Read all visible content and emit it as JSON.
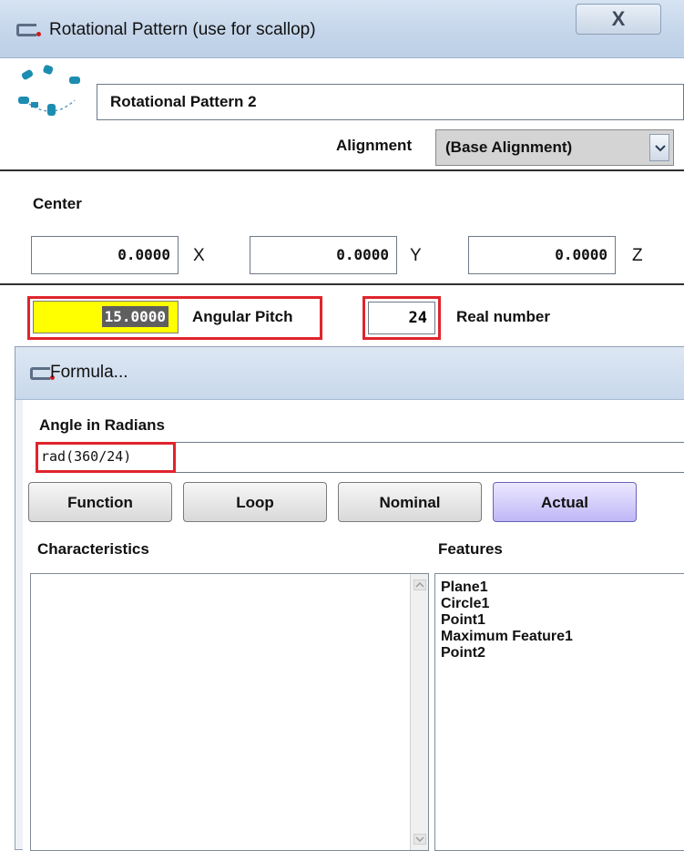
{
  "main_window": {
    "title": "Rotational Pattern (use for scallop)",
    "close_label": "X",
    "name_value": "Rotational Pattern 2",
    "alignment_label": "Alignment",
    "alignment_value": "(Base Alignment)",
    "center_label": "Center",
    "center_x": "0.0000",
    "center_y": "0.0000",
    "center_z": "0.0000",
    "axis_x": "X",
    "axis_y": "Y",
    "axis_z": "Z",
    "angular_pitch_value": "15.0000",
    "angular_pitch_label": "Angular Pitch",
    "count_value": "24",
    "count_label": "Real number"
  },
  "formula_window": {
    "title": "Formula...",
    "angle_label": "Angle in Radians",
    "formula_value": "rad(360/24)",
    "buttons": [
      "Function",
      "Loop",
      "Nominal",
      "Actual"
    ],
    "characteristics_label": "Characteristics",
    "features_label": "Features",
    "features": [
      "Plane1",
      "Circle1",
      "Point1",
      "Maximum Feature1",
      "Point2"
    ]
  },
  "colors": {
    "highlight_field": "#ffff00",
    "annotation_red": "#e0242c",
    "active_button": "#bfb7f7"
  }
}
